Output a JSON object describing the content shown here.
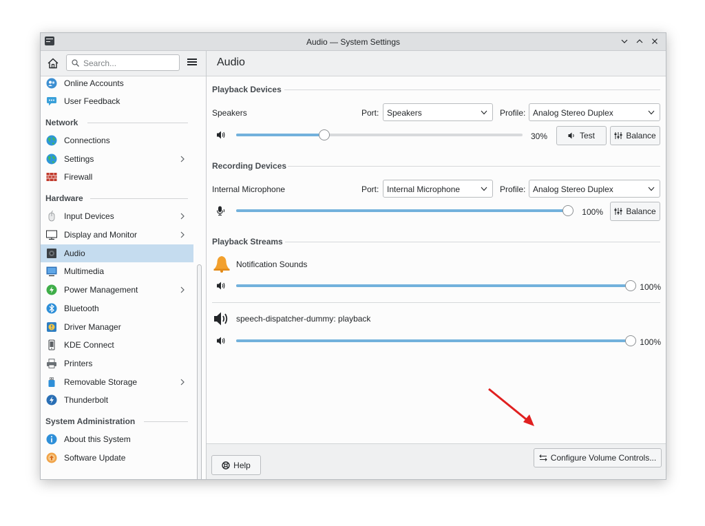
{
  "window": {
    "title": "Audio — System Settings"
  },
  "sidebar": {
    "search_placeholder": "Search...",
    "items": [
      {
        "label": "Online Accounts",
        "icon": "online-accounts-icon"
      },
      {
        "label": "User Feedback",
        "icon": "user-feedback-icon"
      },
      {
        "category": "Network"
      },
      {
        "label": "Connections",
        "icon": "globe-icon"
      },
      {
        "label": "Settings",
        "icon": "globe-icon",
        "has_submenu": true
      },
      {
        "label": "Firewall",
        "icon": "firewall-icon"
      },
      {
        "category": "Hardware"
      },
      {
        "label": "Input Devices",
        "icon": "mouse-icon",
        "has_submenu": true
      },
      {
        "label": "Display and Monitor",
        "icon": "monitor-icon",
        "has_submenu": true
      },
      {
        "label": "Audio",
        "icon": "speaker-icon",
        "active": true
      },
      {
        "label": "Multimedia",
        "icon": "multimedia-icon"
      },
      {
        "label": "Power Management",
        "icon": "power-icon",
        "has_submenu": true
      },
      {
        "label": "Bluetooth",
        "icon": "bluetooth-icon"
      },
      {
        "label": "Driver Manager",
        "icon": "driver-manager-icon"
      },
      {
        "label": "KDE Connect",
        "icon": "phone-icon"
      },
      {
        "label": "Printers",
        "icon": "printer-icon"
      },
      {
        "label": "Removable Storage",
        "icon": "usb-icon",
        "has_submenu": true
      },
      {
        "label": "Thunderbolt",
        "icon": "thunderbolt-icon"
      },
      {
        "category": "System Administration"
      },
      {
        "label": "About this System",
        "icon": "info-icon"
      },
      {
        "label": "Software Update",
        "icon": "software-update-icon"
      }
    ]
  },
  "main": {
    "title": "Audio",
    "playback_devices": {
      "heading": "Playback Devices",
      "device_name": "Speakers",
      "port_label": "Port:",
      "port_value": "Speakers",
      "profile_label": "Profile:",
      "profile_value": "Analog Stereo Duplex",
      "volume_percent": 30,
      "volume_text": "30%",
      "test_label": "Test",
      "balance_label": "Balance"
    },
    "recording_devices": {
      "heading": "Recording Devices",
      "device_name": "Internal Microphone",
      "port_label": "Port:",
      "port_value": "Internal Microphone",
      "profile_label": "Profile:",
      "profile_value": "Analog Stereo Duplex",
      "volume_percent": 100,
      "volume_text": "100%",
      "balance_label": "Balance"
    },
    "playback_streams": {
      "heading": "Playback Streams",
      "streams": [
        {
          "name": "Notification Sounds",
          "icon": "bell-icon",
          "volume_percent": 100,
          "volume_text": "100%"
        },
        {
          "name": "speech-dispatcher-dummy: playback",
          "icon": "speaker-icon",
          "volume_percent": 100,
          "volume_text": "100%"
        }
      ]
    },
    "configure_label": "Configure Volume Controls...",
    "help_label": "Help"
  },
  "colors": {
    "accent": "#3daee9",
    "slider_fill": "#72b1dc",
    "selection": "#c5dcef",
    "annotation_arrow": "#e02020"
  }
}
